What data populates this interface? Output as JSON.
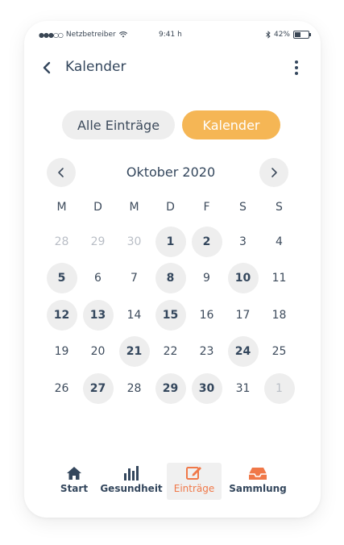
{
  "status": {
    "carrier": "Netzbetreiber",
    "time": "9:41 h",
    "battery": "42%"
  },
  "header": {
    "title": "Kalender"
  },
  "segments": {
    "all": "Alle Einträge",
    "calendar": "Kalender"
  },
  "calendar": {
    "month": "Oktober 2020",
    "weekdays": [
      "M",
      "D",
      "M",
      "D",
      "F",
      "S",
      "S"
    ],
    "weeks": [
      [
        {
          "d": "28",
          "muted": true
        },
        {
          "d": "29",
          "muted": true
        },
        {
          "d": "30",
          "muted": true
        },
        {
          "d": "1",
          "marked": true
        },
        {
          "d": "2",
          "marked": true
        },
        {
          "d": "3"
        },
        {
          "d": "4"
        }
      ],
      [
        {
          "d": "5",
          "marked": true
        },
        {
          "d": "6"
        },
        {
          "d": "7"
        },
        {
          "d": "8",
          "marked": true
        },
        {
          "d": "9"
        },
        {
          "d": "10",
          "marked": true
        },
        {
          "d": "11"
        }
      ],
      [
        {
          "d": "12",
          "marked": true
        },
        {
          "d": "13",
          "marked": true
        },
        {
          "d": "14"
        },
        {
          "d": "15",
          "marked": true
        },
        {
          "d": "16"
        },
        {
          "d": "17"
        },
        {
          "d": "18"
        }
      ],
      [
        {
          "d": "19"
        },
        {
          "d": "20"
        },
        {
          "d": "21",
          "marked": true
        },
        {
          "d": "22"
        },
        {
          "d": "23"
        },
        {
          "d": "24",
          "marked": true
        },
        {
          "d": "25"
        }
      ],
      [
        {
          "d": "26"
        },
        {
          "d": "27",
          "marked": true
        },
        {
          "d": "28"
        },
        {
          "d": "29",
          "marked": true
        },
        {
          "d": "30",
          "marked": true
        },
        {
          "d": "31"
        },
        {
          "d": "1",
          "muted": true,
          "marked": true
        }
      ]
    ]
  },
  "tabs": [
    {
      "label": "Start",
      "icon": "home-icon"
    },
    {
      "label": "Gesundheit",
      "icon": "bar-chart-icon"
    },
    {
      "label": "Einträge",
      "icon": "edit-icon",
      "active": true
    },
    {
      "label": "Sammlung",
      "icon": "inbox-icon"
    }
  ],
  "colors": {
    "accent": "#f5b655",
    "active_tab": "#f07848",
    "text": "#34475d",
    "pill": "#eeeeee"
  }
}
